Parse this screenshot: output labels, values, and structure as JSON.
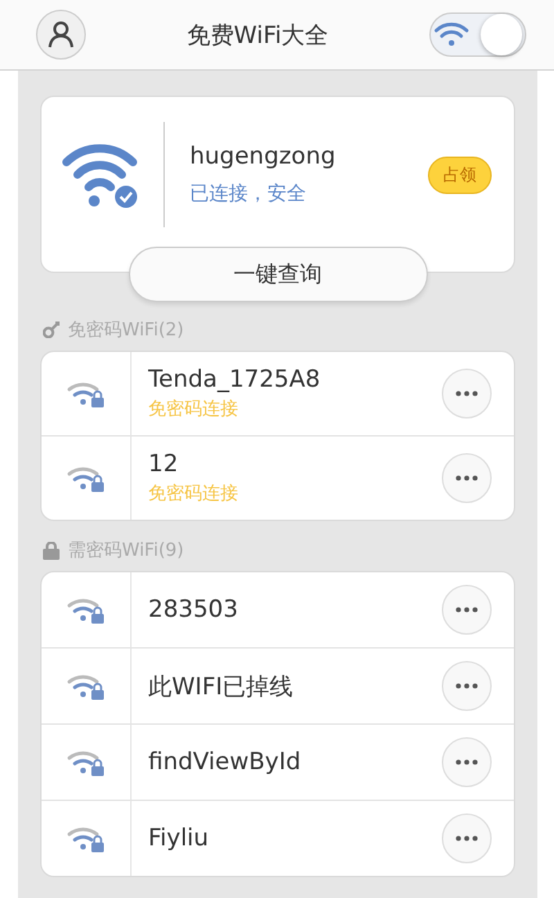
{
  "header": {
    "title": "免费WiFi大全",
    "wifi_switch": {
      "on": true
    }
  },
  "current": {
    "name": "hugengzong",
    "status": "已连接，安全",
    "claim_button": "占领",
    "query_button": "一键查询"
  },
  "sections": [
    {
      "kind": "free",
      "title": "免密码WiFi(2)",
      "networks": [
        {
          "name": "Tenda_1725A8",
          "note": "免密码连接"
        },
        {
          "name": "12",
          "note": "免密码连接"
        }
      ]
    },
    {
      "kind": "locked",
      "title": "需密码WiFi(9)",
      "networks": [
        {
          "name": "283503"
        },
        {
          "name": "此WIFI已掉线"
        },
        {
          "name": "findViewById"
        },
        {
          "name": "Fiyliu"
        }
      ]
    }
  ]
}
